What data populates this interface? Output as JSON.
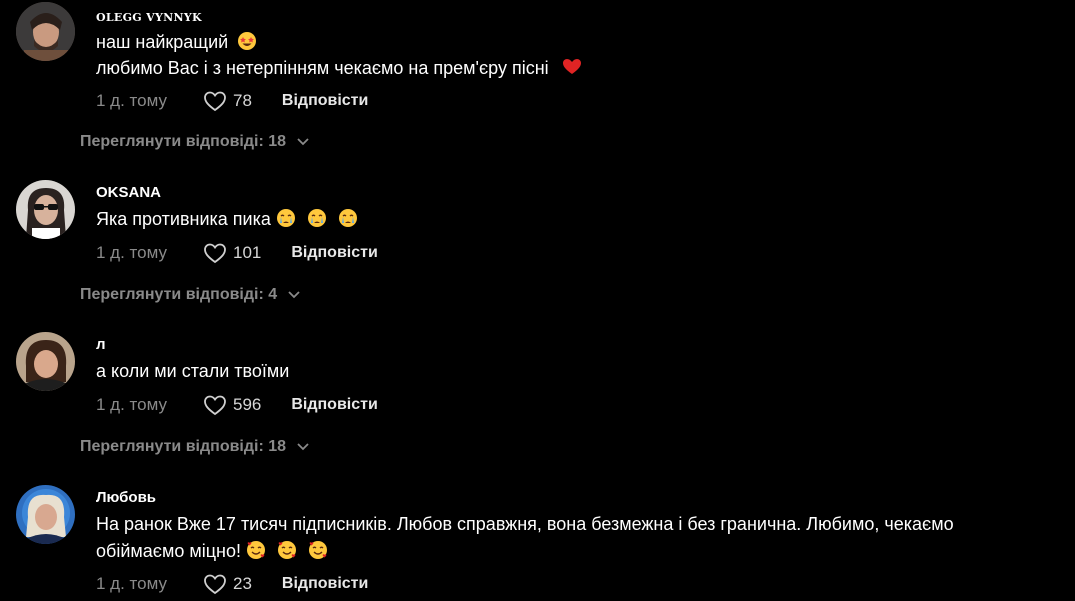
{
  "comments": [
    {
      "username": "OLEGG VYNNYK",
      "lines": [
        "наш найкращий",
        "любимо Вас і з нетерпінням чекаємо на прем'єру пісні"
      ],
      "line_emojis": [
        "star-struck-face-icon",
        "red-heart-icon"
      ],
      "time": "1 д. тому",
      "likes": "78",
      "reply_label": "Відповісти",
      "view_replies": "Переглянути відповіді: 18"
    },
    {
      "username": "OKSANA",
      "lines": [
        "Яка противника пика"
      ],
      "line_emojis": [
        "crying-face-icon"
      ],
      "time": "1 д. тому",
      "likes": "101",
      "reply_label": "Відповісти",
      "view_replies": "Переглянути відповіді: 4"
    },
    {
      "username": "л",
      "lines": [
        "а коли ми стали твоїми"
      ],
      "time": "1 д. тому",
      "likes": "596",
      "reply_label": "Відповісти",
      "view_replies": "Переглянути відповіді: 18"
    },
    {
      "username": "Любовь",
      "lines": [
        "На ранок Вже 17 тисяч підписників. Любов справжня, вона безмежна і без гранична. Любимо, чекаємо",
        "обіймаємо міцно!"
      ],
      "line_emojis": [
        "smiling-face-with-hearts-icon"
      ],
      "time": "1 д. тому",
      "likes": "23",
      "reply_label": "Відповісти"
    }
  ],
  "colors": {
    "background": "#000000",
    "text": "#ffffff",
    "muted": "#8a8a8a",
    "heart_emoji": "#e02424",
    "emoji_yellow": "#ffc83d"
  }
}
